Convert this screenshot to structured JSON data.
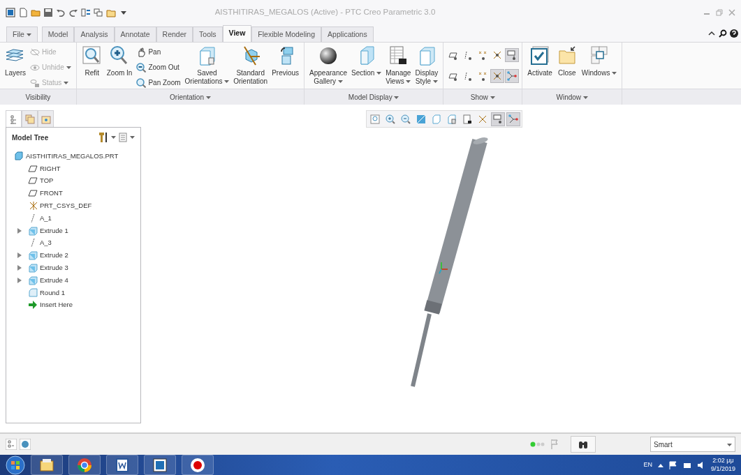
{
  "window": {
    "title": "AISTHITIRAS_MEGALOS (Active) - PTC Creo Parametric 3.0"
  },
  "menu_tabs": [
    {
      "label": "File",
      "kind": "menu",
      "selected": false
    },
    {
      "label": "Model",
      "kind": "tab",
      "selected": false
    },
    {
      "label": "Analysis",
      "kind": "tab",
      "selected": false
    },
    {
      "label": "Annotate",
      "kind": "tab",
      "selected": false
    },
    {
      "label": "Render",
      "kind": "tab",
      "selected": false
    },
    {
      "label": "Tools",
      "kind": "tab",
      "selected": false
    },
    {
      "label": "View",
      "kind": "tab",
      "selected": true
    },
    {
      "label": "Flexible Modeling",
      "kind": "tab",
      "selected": false
    },
    {
      "label": "Applications",
      "kind": "tab",
      "selected": false
    }
  ],
  "ribbon_groups": [
    {
      "label": "Visibility",
      "dropdown": false,
      "commands": [
        {
          "kind": "large",
          "label": "Layers",
          "disabled": false,
          "dropdown": false
        },
        {
          "kind": "small",
          "label": "Hide",
          "disabled": true,
          "dropdown": false
        },
        {
          "kind": "small",
          "label": "Unhide",
          "disabled": true,
          "dropdown": true
        },
        {
          "kind": "small",
          "label": "Status",
          "disabled": true,
          "dropdown": true
        }
      ]
    },
    {
      "label": "Orientation",
      "dropdown": true,
      "commands": [
        {
          "kind": "large",
          "label": "Refit",
          "disabled": false,
          "dropdown": false
        },
        {
          "kind": "large",
          "label": "Zoom In",
          "disabled": false,
          "dropdown": false
        },
        {
          "kind": "small",
          "label": "Pan",
          "disabled": false,
          "dropdown": false
        },
        {
          "kind": "small",
          "label": "Zoom Out",
          "disabled": false,
          "dropdown": false
        },
        {
          "kind": "small",
          "label": "Pan Zoom",
          "disabled": false,
          "dropdown": false
        },
        {
          "kind": "large",
          "label": "Saved\nOrientations",
          "disabled": false,
          "dropdown": true
        },
        {
          "kind": "large",
          "label": "Standard\nOrientation",
          "disabled": false,
          "dropdown": false
        },
        {
          "kind": "large",
          "label": "Previous",
          "disabled": false,
          "dropdown": false
        }
      ]
    },
    {
      "label": "Model Display",
      "dropdown": true,
      "commands": [
        {
          "kind": "large",
          "label": "Appearance\nGallery",
          "disabled": false,
          "dropdown": true
        },
        {
          "kind": "large",
          "label": "Section",
          "disabled": false,
          "dropdown": true
        },
        {
          "kind": "large",
          "label": "Manage\nViews",
          "disabled": false,
          "dropdown": true
        },
        {
          "kind": "large",
          "label": "Display\nStyle",
          "disabled": false,
          "dropdown": true
        }
      ]
    },
    {
      "label": "Show",
      "dropdown": true,
      "commands": [
        {
          "kind": "toggle",
          "on": false
        },
        {
          "kind": "toggle",
          "on": false
        },
        {
          "kind": "toggle",
          "on": false
        },
        {
          "kind": "toggle",
          "on": false
        },
        {
          "kind": "toggle",
          "on": true
        },
        {
          "kind": "toggle",
          "on": false
        },
        {
          "kind": "toggle",
          "on": false
        },
        {
          "kind": "toggle",
          "on": false
        },
        {
          "kind": "toggle",
          "on": true
        },
        {
          "kind": "toggle",
          "on": true
        }
      ]
    },
    {
      "label": "Window",
      "dropdown": true,
      "commands": [
        {
          "kind": "large",
          "label": "Activate",
          "disabled": false,
          "dropdown": false
        },
        {
          "kind": "large",
          "label": "Close",
          "disabled": false,
          "dropdown": false
        },
        {
          "kind": "large",
          "label": "Windows",
          "disabled": false,
          "dropdown": true
        }
      ]
    }
  ],
  "navigator_tabs": [
    {
      "selected": true
    },
    {
      "selected": false
    },
    {
      "selected": false
    }
  ],
  "model_tree": {
    "title": "Model Tree",
    "items": [
      {
        "label": "AISTHITIRAS_MEGALOS.PRT",
        "kind": "part",
        "expander": false,
        "children": [
          {
            "label": "RIGHT",
            "kind": "plane",
            "expander": false
          },
          {
            "label": "TOP",
            "kind": "plane",
            "expander": false
          },
          {
            "label": "FRONT",
            "kind": "plane",
            "expander": false
          },
          {
            "label": "PRT_CSYS_DEF",
            "kind": "csys",
            "expander": false
          },
          {
            "label": "A_1",
            "kind": "axis",
            "expander": false
          },
          {
            "label": "Extrude 1",
            "kind": "extrude",
            "expander": true
          },
          {
            "label": "A_3",
            "kind": "axis",
            "expander": false
          },
          {
            "label": "Extrude 2",
            "kind": "extrude",
            "expander": true
          },
          {
            "label": "Extrude 3",
            "kind": "extrude",
            "expander": true
          },
          {
            "label": "Extrude 4",
            "kind": "extrude",
            "expander": true
          },
          {
            "label": "Round 1",
            "kind": "round",
            "expander": false
          },
          {
            "label": "Insert Here",
            "kind": "insert",
            "expander": false
          }
        ]
      }
    ]
  },
  "view_toolbar": [
    {
      "on": false
    },
    {
      "on": false
    },
    {
      "on": false
    },
    {
      "on": false
    },
    {
      "on": false
    },
    {
      "on": false
    },
    {
      "on": false
    },
    {
      "on": false
    },
    {
      "on": true
    },
    {
      "on": true
    }
  ],
  "status_bar": {
    "filter": "Smart"
  },
  "taskbar": {
    "language": "EN",
    "time": "2:02 μμ",
    "date": "9/1/2019"
  }
}
